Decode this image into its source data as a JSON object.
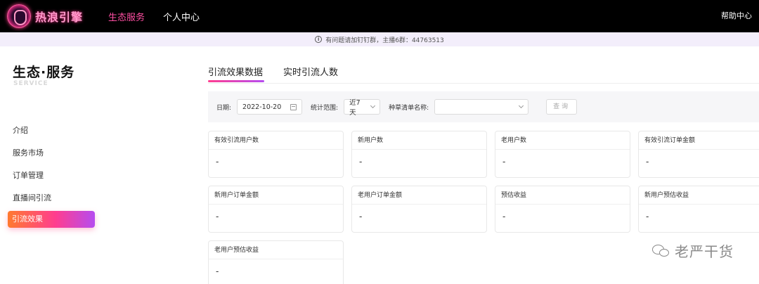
{
  "header": {
    "logo_text": "热浪引擎",
    "nav": [
      {
        "label": "生态服务",
        "active": true
      },
      {
        "label": "个人中心",
        "active": false
      }
    ],
    "help_label": "帮助中心",
    "accent_color": "#ff4fa3"
  },
  "notice": {
    "text": "有问题请加钉钉群，主播6群：44763513"
  },
  "sidebar": {
    "title": "生态·服务",
    "subtitle": "SERVICE",
    "items": [
      {
        "label": "介绍",
        "active": false
      },
      {
        "label": "服务市场",
        "active": false
      },
      {
        "label": "订单管理",
        "active": false
      },
      {
        "label": "直播间引流",
        "active": false
      },
      {
        "label": "引流效果",
        "active": true
      }
    ]
  },
  "tabs": [
    {
      "label": "引流效果数据",
      "active": true
    },
    {
      "label": "实时引流人数",
      "active": false
    }
  ],
  "filters": {
    "date_label": "日期:",
    "date_value": "2022-10-20",
    "range_label": "统计范围:",
    "range_value": "近7天",
    "list_label": "种草清单名称:",
    "list_value": "",
    "query_label": "查询"
  },
  "cards": [
    {
      "title": "有效引流用户数",
      "value": "-"
    },
    {
      "title": "新用户数",
      "value": "-"
    },
    {
      "title": "老用户数",
      "value": "-"
    },
    {
      "title": "有效引流订单金额",
      "value": "-"
    },
    {
      "title": "新用户订单金额",
      "value": "-"
    },
    {
      "title": "老用户订单金额",
      "value": "-"
    },
    {
      "title": "预估收益",
      "value": "-"
    },
    {
      "title": "新用户预估收益",
      "value": "-"
    },
    {
      "title": "老用户预估收益",
      "value": "-"
    }
  ],
  "watermark": {
    "text": "老严干货",
    "icon": "wechat-icon"
  }
}
